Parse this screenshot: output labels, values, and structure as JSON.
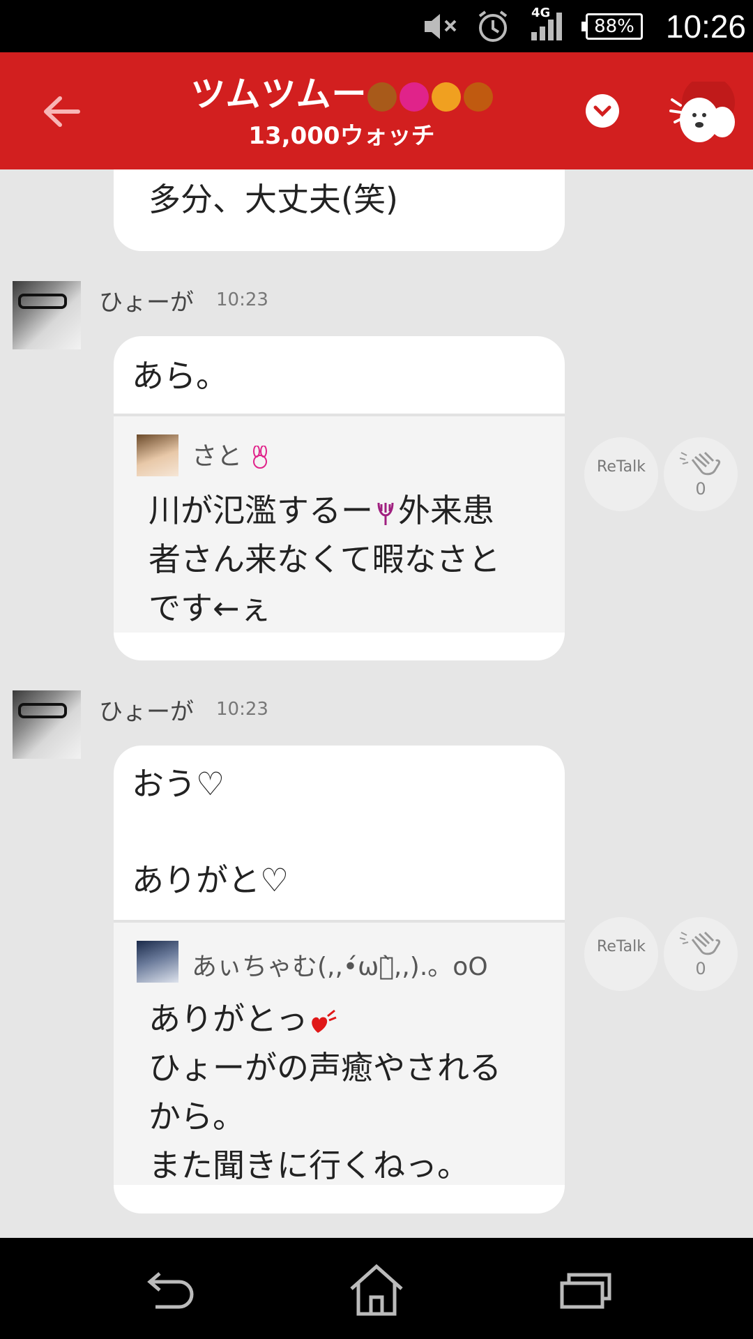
{
  "status_bar": {
    "network": "4G",
    "battery": "88%",
    "time": "10:26",
    "icons": [
      "mute-icon",
      "alarm-icon",
      "signal-icon",
      "battery-icon"
    ]
  },
  "header": {
    "title": "ツムツムー",
    "watch_count": "13,000ウォッチ",
    "title_emoji_icons": [
      "bear-icon",
      "rabbit-icon",
      "cat-icon",
      "dog-icon"
    ],
    "brand_color": "#d21f1f"
  },
  "messages": [
    {
      "text": "多分、大丈夫(笑)"
    },
    {
      "sender": "ひょーが",
      "time": "10:23",
      "text": "あら。",
      "quote": {
        "name": "さと",
        "text_lines": [
          "川が氾濫するー",
          "外来患",
          "者さん来なくて暇なさと",
          "です←ぇ"
        ]
      },
      "retalk_label": "ReTalk",
      "clap_count": "0"
    },
    {
      "sender": "ひょーが",
      "time": "10:23",
      "text_lines": [
        "おう♡",
        "ありがと♡"
      ],
      "quote": {
        "name": "あぃちゃむ(,,•́ωก̀,,).。oO",
        "text_lines": [
          "ありがとっ",
          "ひょーがの声癒やされる",
          "から。",
          "また聞きに行くねっ。"
        ]
      },
      "retalk_label": "ReTalk",
      "clap_count": "0"
    }
  ]
}
